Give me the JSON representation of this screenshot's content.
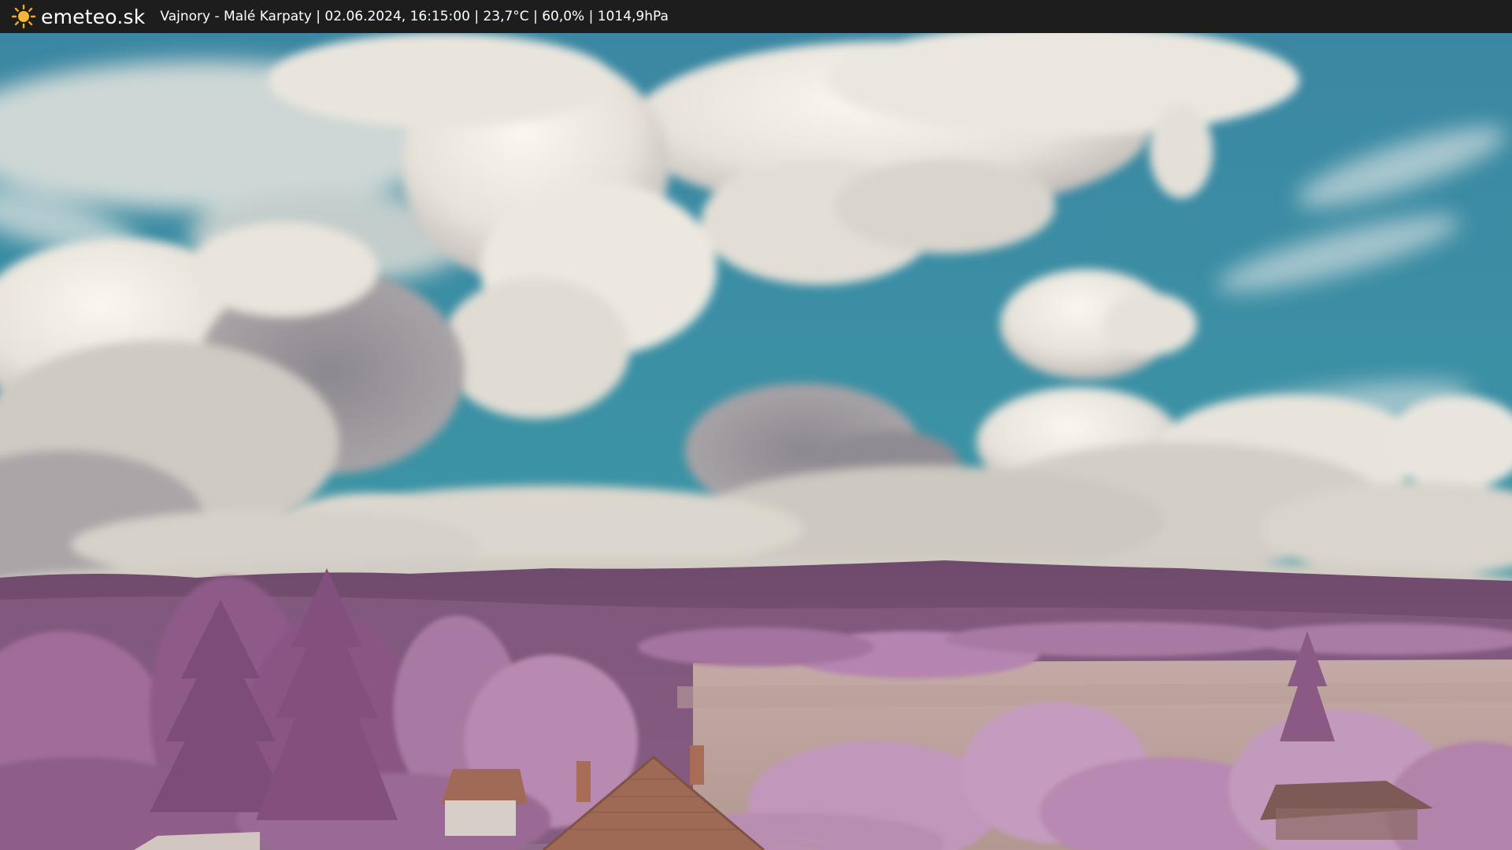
{
  "header": {
    "brand": "emeteo.sk",
    "logo_icon": "sun-icon",
    "caption": "Vajnory - Malé Karpaty | 02.06.2024, 16:15:00 | 23,7°C | 60,0% | 1014,9hPa"
  },
  "colors": {
    "topbar": "#1d1d1d",
    "sun": "#f5a623",
    "sky": "#3a8fa6",
    "foliage": "#b078a8",
    "hills": "#7e5478"
  }
}
